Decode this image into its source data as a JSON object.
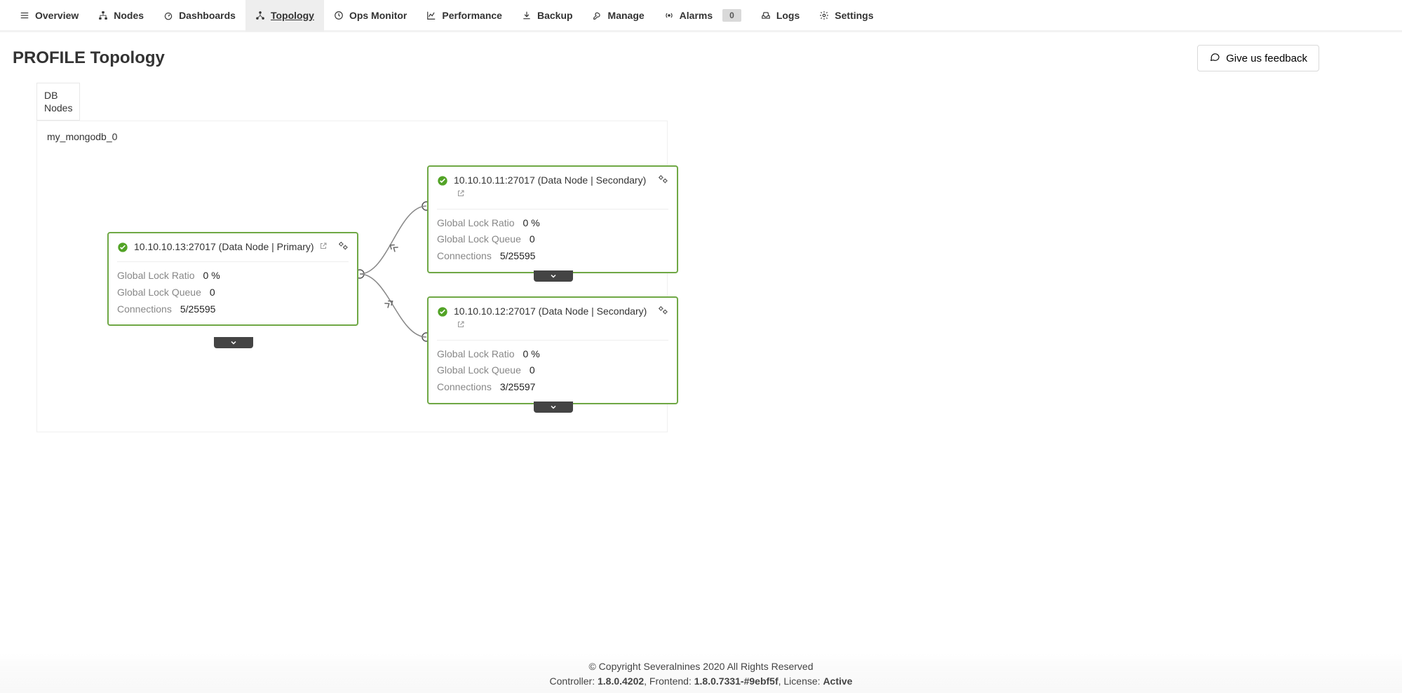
{
  "nav": {
    "overview": "Overview",
    "nodes": "Nodes",
    "dashboards": "Dashboards",
    "topology": "Topology",
    "ops_monitor": "Ops Monitor",
    "performance": "Performance",
    "backup": "Backup",
    "manage": "Manage",
    "alarms": "Alarms",
    "alarms_count": "0",
    "logs": "Logs",
    "settings": "Settings"
  },
  "page": {
    "title": "PROFILE Topology",
    "feedback": "Give us feedback",
    "db_tab_line1": "DB",
    "db_tab_line2": "Nodes"
  },
  "cluster": {
    "name": "my_mongodb_0"
  },
  "labels": {
    "lock_ratio": "Global Lock Ratio",
    "lock_queue": "Global Lock Queue",
    "connections": "Connections"
  },
  "nodes": {
    "primary": {
      "title": "10.10.10.13:27017 (Data Node | Primary)",
      "lock_ratio": "0 %",
      "lock_queue": "0",
      "connections": "5/25595"
    },
    "sec1": {
      "title": "10.10.10.11:27017 (Data Node | Secondary)",
      "lock_ratio": "0 %",
      "lock_queue": "0",
      "connections": "5/25595"
    },
    "sec2": {
      "title": "10.10.10.12:27017 (Data Node | Secondary)",
      "lock_ratio": "0 %",
      "lock_queue": "0",
      "connections": "3/25597"
    }
  },
  "footer": {
    "copyright": "© Copyright Severalnines 2020 All Rights Reserved",
    "controller_label": "Controller: ",
    "controller_ver": "1.8.0.4202",
    "frontend_label": ", Frontend: ",
    "frontend_ver": "1.8.0.7331-#9ebf5f",
    "license_label": ", License: ",
    "license_val": "Active"
  }
}
